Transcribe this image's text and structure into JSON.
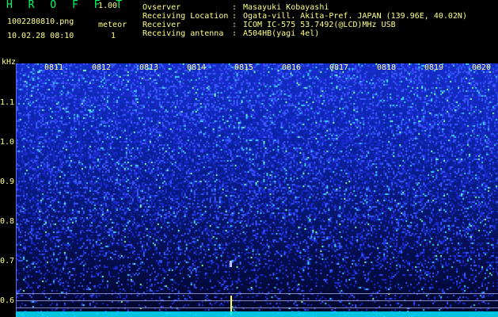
{
  "app": {
    "logo": "H R O F F T",
    "version": "1.00",
    "file": "1002280810.png",
    "mode": "meteor",
    "timestamp": "10.02.28 08:10",
    "count": "1"
  },
  "info": [
    {
      "label": "Ovserver",
      "value": "Masayuki Kobayashi"
    },
    {
      "label": "Receiving Location",
      "value": "Ogata-vill. Akita-Pref. JAPAN (139.96E, 40.02N)"
    },
    {
      "label": "Receiver",
      "value": "ICOM IC-575 53.7492(@LCD)MHz USB"
    },
    {
      "label": "Receiving antenna",
      "value": "A504HB(yagi 4el)"
    }
  ],
  "separator": ":",
  "axis": {
    "unit": "kHz",
    "ticks": [
      "1.1",
      "1.0",
      "0.9",
      "0.8",
      "0.7",
      "0.6"
    ],
    "time_labels": [
      "0811",
      "0812",
      "0813",
      "0814",
      "0815",
      "0816",
      "0817",
      "0818",
      "0819",
      "0820"
    ]
  },
  "colors": {
    "text_yellow": "#ffff88",
    "logo_green": "#00ff66",
    "noise_blue": "#1a3cff",
    "baseline_cyan": "#00e5ff"
  }
}
